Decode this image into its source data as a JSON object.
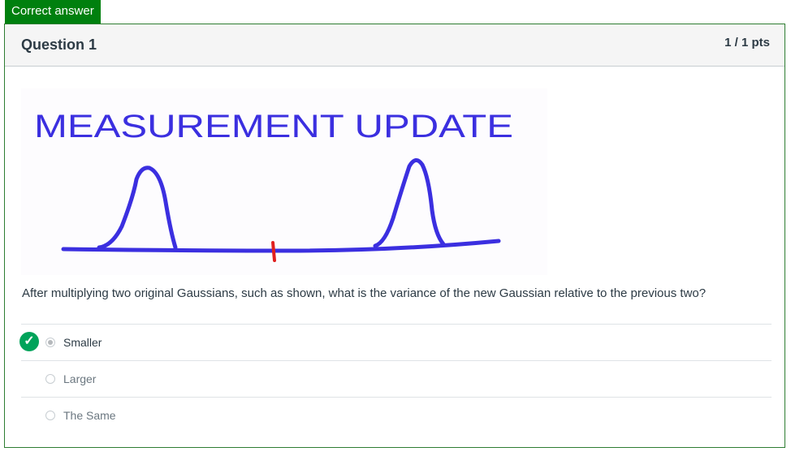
{
  "status_tag": "Correct answer",
  "question": {
    "title": "Question 1",
    "points": "1 / 1 pts",
    "figure_text": "MEASUREMENT UPDATE",
    "prompt": "After multiplying two original Gaussians, such as shown, what is the variance of the new Gaussian relative to the previous two?"
  },
  "answers": [
    {
      "label": "Smaller",
      "selected": true,
      "correct": true
    },
    {
      "label": "Larger",
      "selected": false,
      "correct": false
    },
    {
      "label": "The Same",
      "selected": false,
      "correct": false
    }
  ],
  "colors": {
    "correct_green": "#00800e",
    "ink_blue": "#3b2fe0",
    "marker_red": "#e02020"
  },
  "icons": [
    "check-icon"
  ]
}
